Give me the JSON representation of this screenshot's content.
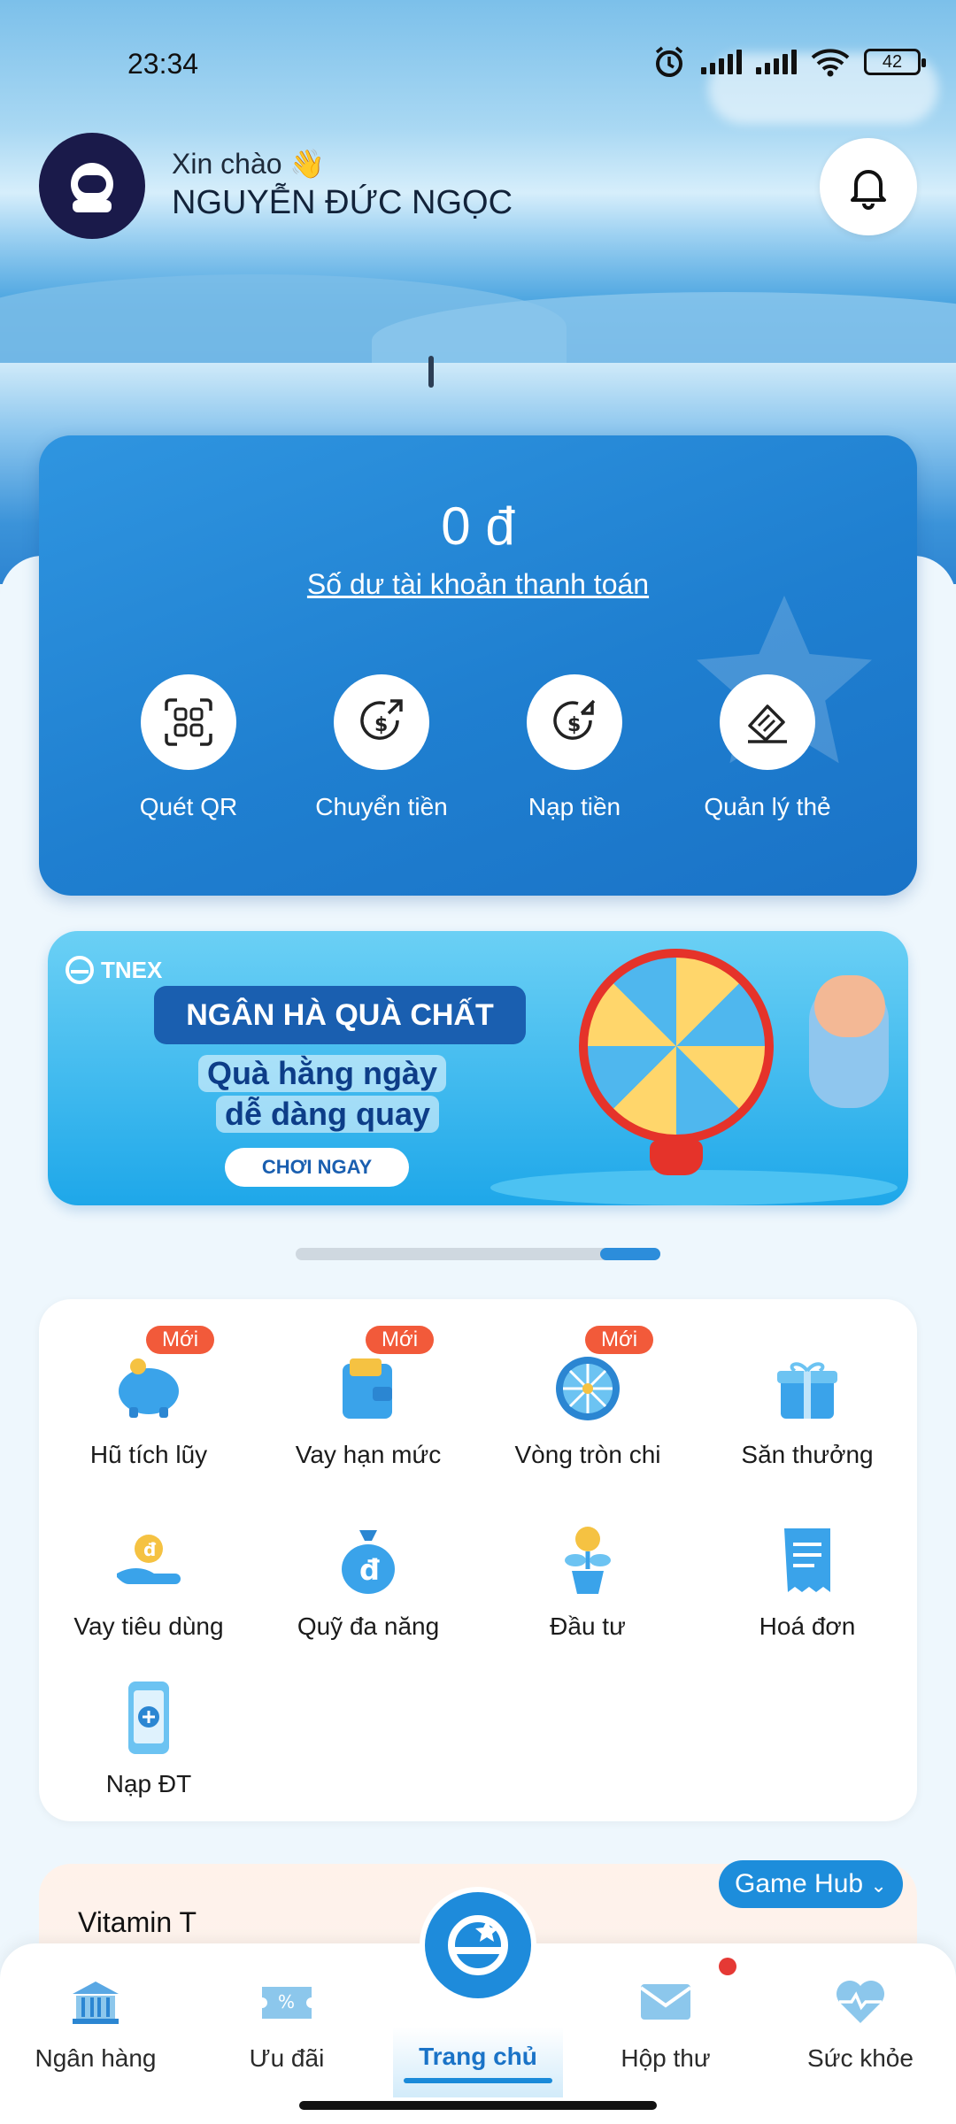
{
  "status_bar": {
    "time": "23:34",
    "battery": "42"
  },
  "header": {
    "greeting": "Xin chào 👋",
    "user_name": "NGUYỄN ĐỨC NGỌC"
  },
  "balance": {
    "amount": "0 đ",
    "label": "Số dư tài khoản thanh toán"
  },
  "actions": [
    {
      "label": "Quét QR",
      "icon": "qr-scan-icon"
    },
    {
      "label": "Chuyển tiền",
      "icon": "transfer-icon"
    },
    {
      "label": "Nạp tiền",
      "icon": "deposit-icon"
    },
    {
      "label": "Quản lý thẻ",
      "icon": "card-icon"
    }
  ],
  "banner": {
    "brand": "TNEX",
    "title": "NGÂN HÀ QUÀ CHẤT",
    "line1": "Quà hằng ngày",
    "line2": "dễ dàng quay",
    "cta": "CHƠI NGAY",
    "carousel": {
      "index": 2,
      "total": 2
    }
  },
  "services": [
    {
      "label": "Hũ tích lũy",
      "badge": "Mới",
      "icon": "piggy-bank-icon"
    },
    {
      "label": "Vay hạn mức",
      "badge": "Mới",
      "icon": "wallet-icon"
    },
    {
      "label": "Vòng tròn chi",
      "badge": "Mới",
      "icon": "spin-wheel-icon"
    },
    {
      "label": "Săn thưởng",
      "badge": "",
      "icon": "gift-icon"
    },
    {
      "label": "Vay tiêu dùng",
      "badge": "",
      "icon": "coin-hand-icon"
    },
    {
      "label": "Quỹ đa năng",
      "badge": "",
      "icon": "money-bag-icon"
    },
    {
      "label": "Đầu tư",
      "badge": "",
      "icon": "plant-coin-icon"
    },
    {
      "label": "Hoá đơn",
      "badge": "",
      "icon": "bill-icon"
    },
    {
      "label": "Nạp ĐT",
      "badge": "",
      "icon": "phone-topup-icon"
    }
  ],
  "vitamin": {
    "title": "Vitamin T",
    "game_hub": "Game Hub"
  },
  "nav": {
    "items": [
      {
        "label": "Ngân hàng",
        "icon": "bank-icon"
      },
      {
        "label": "Ưu đãi",
        "icon": "voucher-icon"
      },
      {
        "label": "Trang chủ",
        "icon": "home-logo-icon",
        "active": true
      },
      {
        "label": "Hộp thư",
        "icon": "mail-icon"
      },
      {
        "label": "Sức khỏe",
        "icon": "health-heart-icon"
      }
    ]
  },
  "colors": {
    "primary": "#1a73c7",
    "badge": "#f25a3a",
    "notification_dot": "#e53935"
  }
}
